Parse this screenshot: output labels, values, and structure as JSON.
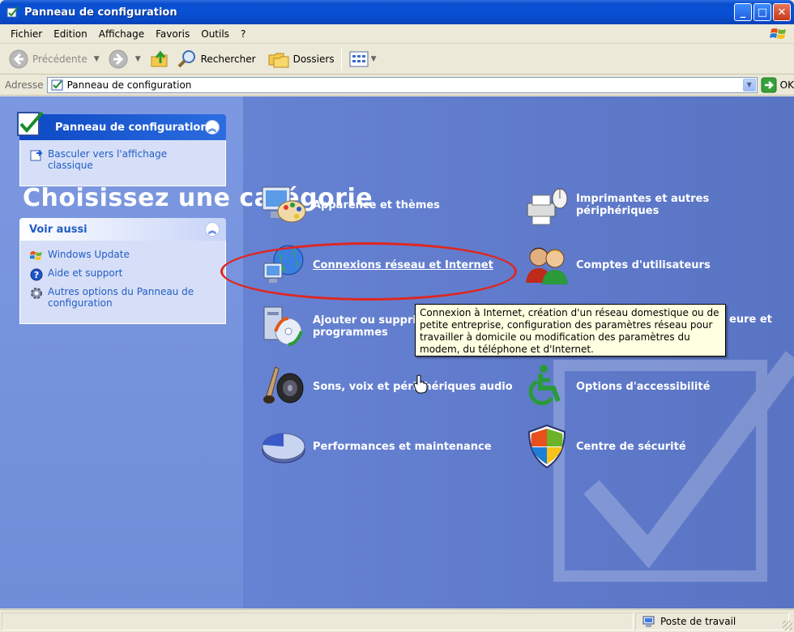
{
  "window": {
    "title": "Panneau de configuration"
  },
  "menu": [
    "Fichier",
    "Edition",
    "Affichage",
    "Favoris",
    "Outils",
    "?"
  ],
  "toolbar": {
    "back_label": "Précédente",
    "search_label": "Rechercher",
    "folders_label": "Dossiers"
  },
  "address": {
    "label": "Adresse",
    "value": "Panneau de configuration",
    "go_label": "OK"
  },
  "sidebar": {
    "main_box": {
      "title": "Panneau de configuration",
      "items": [
        {
          "label": "Basculer vers l'affichage classique",
          "icon": "switch-view-icon"
        }
      ]
    },
    "see_also": {
      "title": "Voir aussi",
      "items": [
        {
          "label": "Windows Update",
          "icon": "windows-update-icon"
        },
        {
          "label": "Aide et support",
          "icon": "help-icon"
        },
        {
          "label": "Autres options du Panneau de configuration",
          "icon": "gear-icon"
        }
      ]
    }
  },
  "main": {
    "heading": "Choisissez une catégorie",
    "categories": [
      {
        "label": "Apparence et thèmes",
        "icon": "appearance-themes-icon"
      },
      {
        "label": "Imprimantes et autres périphériques",
        "icon": "printer-icon"
      },
      {
        "label": "Connexions réseau et Internet",
        "icon": "network-globe-icon"
      },
      {
        "label": "Comptes d'utilisateurs",
        "icon": "user-accounts-icon"
      },
      {
        "label": "Ajouter ou supprimer des programmes",
        "icon": "add-remove-programs-icon"
      },
      {
        "label": "Date, heure, langue et options régionales",
        "icon": "date-time-icon"
      },
      {
        "label": "Sons, voix et périphériques audio",
        "icon": "speaker-icon"
      },
      {
        "label": "Options d'accessibilité",
        "icon": "accessibility-icon"
      },
      {
        "label": "Performances et maintenance",
        "icon": "performance-icon"
      },
      {
        "label": "Centre de sécurité",
        "icon": "shield-icon"
      }
    ],
    "partial_labels": {
      "add_remove": "Ajouter ou suppri",
      "add_remove_line2": "programmes",
      "date_time_tail": "eure et"
    },
    "tooltip": "Connexion à Internet, création d'un réseau domestique ou de petite entreprise, configuration des paramètres réseau pour travailler à domicile ou modification des paramètres du modem, du téléphone et d'Internet."
  },
  "status": {
    "zone": "Poste de travail"
  },
  "colors": {
    "xp_blue": "#0a4ecf",
    "highlight_red": "#e0261f",
    "tooltip_bg": "#ffffe1"
  }
}
